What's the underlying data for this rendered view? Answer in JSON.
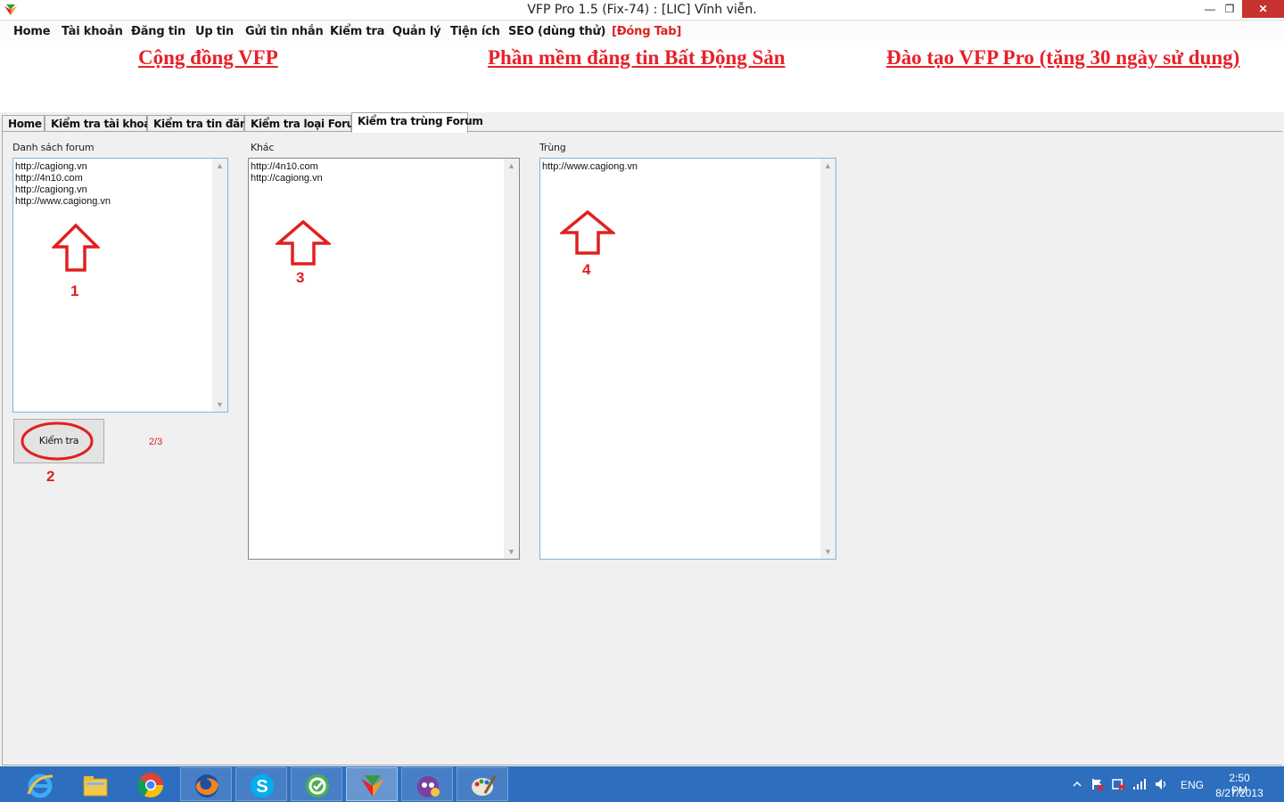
{
  "window": {
    "title": "VFP Pro 1.5 (Fix-74) : [LIC] Vĩnh viễn.",
    "min_glyph": "—",
    "max_glyph": "❐",
    "close_glyph": "✕"
  },
  "menu": {
    "items": [
      {
        "label": "Home"
      },
      {
        "label": "Tài khoản"
      },
      {
        "label": "Đăng tin"
      },
      {
        "label": "Up tin"
      },
      {
        "label": "Gửi tin nhắn"
      },
      {
        "label": "Kiểm tra"
      },
      {
        "label": "Quản lý"
      },
      {
        "label": "Tiện ích"
      },
      {
        "label": "SEO (dùng thử)"
      },
      {
        "label": "[Đóng Tab]"
      }
    ]
  },
  "banner": {
    "links": [
      {
        "label": "Cộng đồng VFP"
      },
      {
        "label": "Phần mềm đăng tin Bất Động Sản"
      },
      {
        "label": "Đào tạo VFP Pro (tặng 30 ngày sử dụng)"
      }
    ]
  },
  "tabs": [
    {
      "label": "Home"
    },
    {
      "label": "Kiểm tra tài khoản"
    },
    {
      "label": "Kiểm tra tin đăng"
    },
    {
      "label": "Kiểm tra loại Forum"
    },
    {
      "label": "Kiểm tra trùng Forum",
      "active": true
    }
  ],
  "panel": {
    "forum_list": {
      "label": "Danh sách forum",
      "lines": [
        "http://cagiong.vn",
        "http://4n10.com",
        "http://cagiong.vn",
        "http://www.cagiong.vn"
      ]
    },
    "other": {
      "label": "Khác",
      "lines": [
        "http://4n10.com",
        "http://cagiong.vn"
      ]
    },
    "duplicate": {
      "label": "Trùng",
      "lines": [
        "http://www.cagiong.vn"
      ]
    },
    "check_button": "Kiểm tra",
    "progress_text": "2/3"
  },
  "annotations": {
    "marker_1": "1",
    "marker_2": "2",
    "marker_3": "3",
    "marker_4": "4",
    "color": "#e02020"
  },
  "taskbar": {
    "apps": [
      "internet-explorer-icon",
      "file-explorer-icon",
      "chrome-icon",
      "firefox-icon",
      "skype-icon",
      "coccoc-icon",
      "vfp-icon",
      "messenger-icon",
      "paint-icon"
    ],
    "language": "ENG",
    "time": "2:50 PM",
    "date": "8/27/2013"
  }
}
